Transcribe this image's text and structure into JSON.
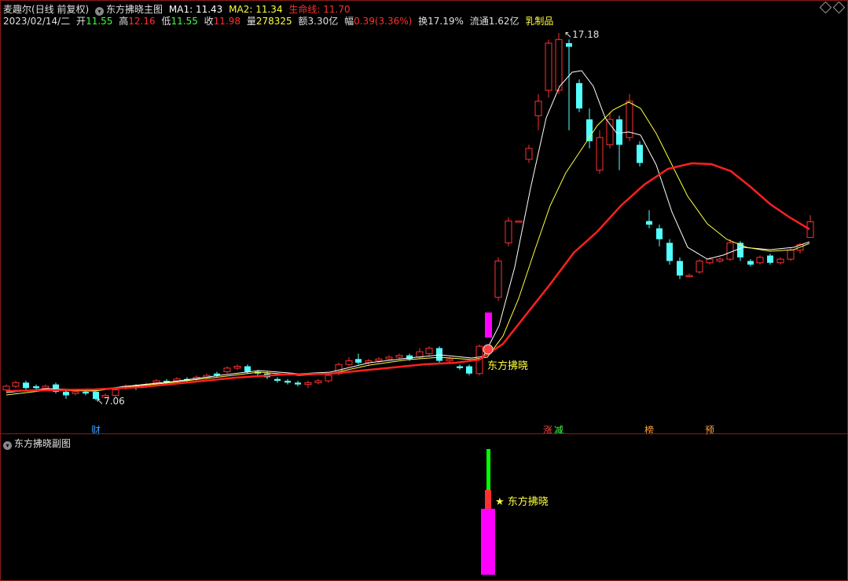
{
  "main_header": {
    "app_name": "麦趣尔",
    "period": "(日线 前复权)",
    "indicator_name": "东方拂晓主图",
    "ma1_label": "MA1:",
    "ma1_value": "11.43",
    "ma2_label": "MA2:",
    "ma2_value": "11.34",
    "life_label": "生命线:",
    "life_value": "11.70"
  },
  "quote_bar": {
    "date": "2023/02/14/二",
    "open_label": "开",
    "open": "11.55",
    "high_label": "高",
    "high": "12.16",
    "low_label": "低",
    "low": "11.55",
    "close_label": "收",
    "close": "11.98",
    "volume_label": "量",
    "volume": "278325",
    "amount_label": "额",
    "amount": "3.30亿",
    "change_label": "幅",
    "change": "0.39(3.36%)",
    "turnover_label": "换",
    "turnover": "17.19%",
    "float_label": "流通",
    "float": "1.62亿",
    "sector": "乳制品"
  },
  "annotations": {
    "high_marker": "17.18",
    "low_marker": "7.06",
    "signal_label": "东方拂晓",
    "sub_signal_label": "★ 东方拂晓"
  },
  "event_tags": [
    {
      "text": "财",
      "color": "#3aa0ff"
    },
    {
      "text": "涨",
      "color": "#ff4040"
    },
    {
      "text": "减",
      "color": "#40ff40"
    },
    {
      "text": "榜",
      "color": "#ffa040"
    },
    {
      "text": "预",
      "color": "#ffa040"
    }
  ],
  "sub_panel": {
    "title": "东方拂晓副图"
  },
  "colors": {
    "up": "#ff3030",
    "down": "#54ffff",
    "ma1": "#ffffff",
    "ma2": "#ffff40",
    "life": "#ff2020",
    "border": "#8b1a1a",
    "signal": "#ffff40",
    "magenta": "#ff00ff",
    "green": "#00ff00"
  },
  "chart_data": {
    "type": "candlestick",
    "price_high": 17.18,
    "price_low": 7.06,
    "last_close": 11.98,
    "ma1": 11.43,
    "ma2": 11.34,
    "life_line": 11.7
  }
}
